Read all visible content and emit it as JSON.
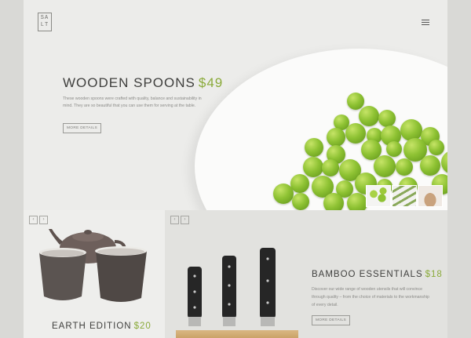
{
  "logo": {
    "line1": "SA",
    "line2": "LT"
  },
  "hero": {
    "title": "WOODEN SPOONS",
    "price": "$49",
    "description": "These wooden spoons were crafted with quality, balance and sustainability in mind. They are so beautiful that you can use them for serving at the table.",
    "button": "MORE DETAILS"
  },
  "earth": {
    "title": "EARTH EDITION",
    "price": "$20",
    "prev": "‹",
    "next": "›"
  },
  "bamboo": {
    "title": "BAMBOO ESSENTIALS",
    "price": "$18",
    "description": "Discover our wide range of wooden utensils that will convince through quality – from the choice of materials to the workmanship of every detail.",
    "button": "MORE DETAILS",
    "prev": "‹",
    "next": "›"
  },
  "colors": {
    "accent": "#8aaa3a",
    "text": "#3f3f3d"
  }
}
